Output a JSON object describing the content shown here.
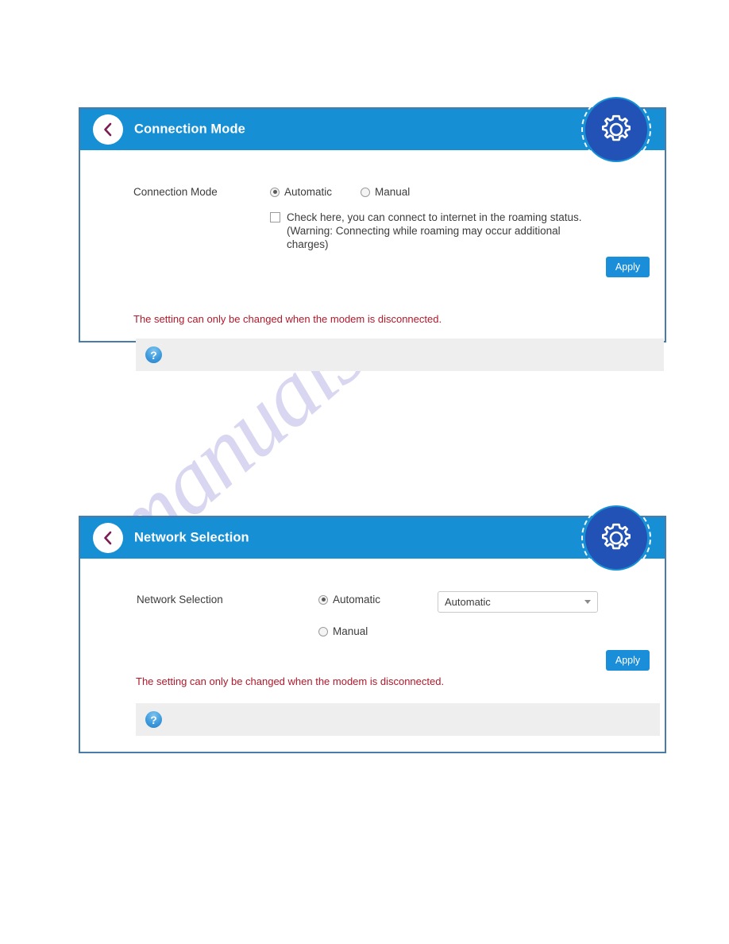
{
  "watermark": {
    "text": "manualshive.com"
  },
  "colors": {
    "header_blue": "#168fd5",
    "gear_blue": "#2252b5",
    "panel_border": "#4a7cab",
    "apply_blue": "#1a8ed8",
    "warning_red": "#b1182a",
    "help_bar_gray": "#eeeeee",
    "back_chevron": "#7b1b52"
  },
  "panels": [
    {
      "id": "connection-mode",
      "title": "Connection Mode",
      "back_icon": "chevron-left-icon",
      "gear_icon": "gear-icon",
      "field_label": "Connection Mode",
      "radios": [
        {
          "label": "Automatic",
          "checked": true
        },
        {
          "label": "Manual",
          "checked": false
        }
      ],
      "checkbox": {
        "checked": false,
        "text": "Check here, you can connect to internet in the roaming status. (Warning: Connecting while roaming may occur additional charges)"
      },
      "apply_label": "Apply",
      "warning": "The setting can only be changed when the modem is disconnected.",
      "help_icon": "question-mark-icon"
    },
    {
      "id": "network-selection",
      "title": "Network Selection",
      "back_icon": "chevron-left-icon",
      "gear_icon": "gear-icon",
      "field_label": "Network Selection",
      "radios": [
        {
          "label": "Automatic",
          "checked": true
        },
        {
          "label": "Manual",
          "checked": false
        }
      ],
      "select": {
        "value": "Automatic",
        "options": [
          "Automatic"
        ]
      },
      "apply_label": "Apply",
      "warning": "The setting can only be changed when the modem is disconnected.",
      "help_icon": "question-mark-icon"
    }
  ]
}
